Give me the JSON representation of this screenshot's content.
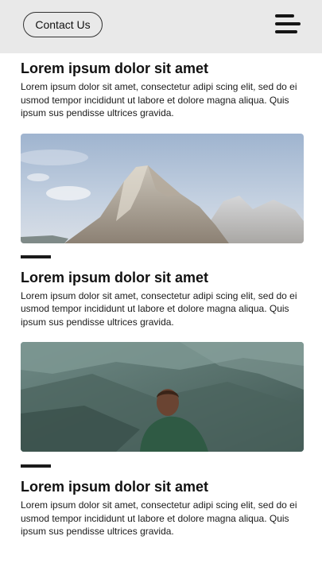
{
  "header": {
    "contact_label": "Contact Us",
    "menu_icon": "hamburger-menu-icon"
  },
  "articles": [
    {
      "title": "Lorem ipsum dolor sit amet",
      "body": "Lorem ipsum dolor sit amet, consectetur adipi scing elit, sed do ei usmod tempor incididunt ut labore et dolore magna aliqua. Quis ipsum sus pendisse ultrices gravida."
    },
    {
      "title": "Lorem ipsum dolor sit amet",
      "body": "Lorem ipsum dolor sit amet, consectetur adipi scing elit, sed do ei usmod tempor incididunt ut labore et dolore magna aliqua. Quis ipsum sus pendisse ultrices gravida."
    },
    {
      "title": "Lorem ipsum dolor sit amet",
      "body": "Lorem ipsum dolor sit amet, consectetur adipi scing elit, sed do ei usmod tempor incididunt ut labore et dolore magna aliqua. Quis ipsum sus pendisse ultrices gravida."
    }
  ],
  "images": [
    {
      "subject": "mountain-peak-photo"
    },
    {
      "subject": "hiker-overlooking-valley-photo"
    }
  ]
}
